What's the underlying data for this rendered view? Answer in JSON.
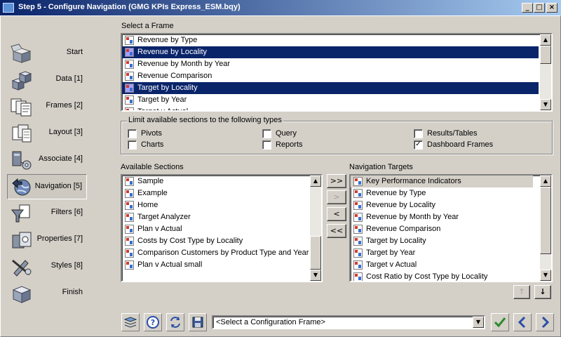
{
  "window": {
    "title": "Step 5 - Configure Navigation (GMG KPIs Express_ESM.bqy)",
    "controls": [
      "minimize-icon",
      "maximize-icon",
      "close-icon"
    ]
  },
  "steps": [
    {
      "label": "Start",
      "icon": "start-box-icon"
    },
    {
      "label": "Data [1]",
      "icon": "data-cubes-icon"
    },
    {
      "label": "Frames [2]",
      "icon": "frames-icon"
    },
    {
      "label": "Layout [3]",
      "icon": "layout-icon"
    },
    {
      "label": "Associate [4]",
      "icon": "associate-icon"
    },
    {
      "label": "Navigation [5]",
      "icon": "navigation-globe-icon",
      "active": true
    },
    {
      "label": "Filters [6]",
      "icon": "filter-funnel-icon"
    },
    {
      "label": "Properties [7]",
      "icon": "properties-icon"
    },
    {
      "label": "Styles [8]",
      "icon": "styles-brush-icon"
    },
    {
      "label": "Finish",
      "icon": "finish-cube-icon"
    }
  ],
  "select_frame": {
    "label": "Select a Frame",
    "items": [
      {
        "text": "Revenue by Type",
        "selected": false
      },
      {
        "text": "Revenue by Locality",
        "selected": true
      },
      {
        "text": "Revenue by Month by Year",
        "selected": false
      },
      {
        "text": "Revenue Comparison",
        "selected": false
      },
      {
        "text": "Target by Locality",
        "selected": true
      },
      {
        "text": "Target by Year",
        "selected": false
      },
      {
        "text": "Target v Actual",
        "selected": false
      }
    ]
  },
  "limit_types": {
    "title": "Limit available sections to the following types",
    "checkboxes": [
      {
        "label": "Pivots",
        "checked": false
      },
      {
        "label": "Charts",
        "checked": false
      },
      {
        "label": "Query",
        "checked": false
      },
      {
        "label": "Reports",
        "checked": false
      },
      {
        "label": "Results/Tables",
        "checked": false
      },
      {
        "label": "Dashboard Frames",
        "checked": true
      }
    ]
  },
  "available_sections": {
    "label": "Available Sections",
    "items": [
      "Sample",
      "Example",
      "Home",
      "Target Analyzer",
      "Plan v Actual",
      "Costs by Cost Type by Locality",
      "Comparison Customers by Product Type and Year",
      "Plan v Actual small"
    ]
  },
  "transfer_buttons": [
    ">>",
    ">",
    "<",
    "<<"
  ],
  "navigation_targets": {
    "label": "Navigation Targets",
    "items": [
      {
        "text": "Key Performance Indicators",
        "highlighted": true
      },
      {
        "text": "Revenue by Type",
        "highlighted": false
      },
      {
        "text": "Revenue by Locality",
        "highlighted": false
      },
      {
        "text": "Revenue by Month by Year",
        "highlighted": false
      },
      {
        "text": "Revenue Comparison",
        "highlighted": false
      },
      {
        "text": "Target by Locality",
        "highlighted": false
      },
      {
        "text": "Target by Year",
        "highlighted": false
      },
      {
        "text": "Target v Actual",
        "highlighted": false
      },
      {
        "text": "Cost Ratio by Cost Type by Locality",
        "highlighted": false
      }
    ]
  },
  "order_buttons": [
    "move-up-icon",
    "move-down-icon"
  ],
  "toolbar": {
    "icons": [
      "stack-icon",
      "help-icon",
      "refresh-icon",
      "save-disk-icon"
    ],
    "combo_value": "<Select a Configuration Frame>",
    "finish_icon": "checkmark-icon",
    "back_icon": "back-arrow-icon",
    "next_icon": "next-arrow-icon"
  },
  "colors": {
    "selection": "#0a246a",
    "title_start": "#0a246a",
    "title_end": "#a6caf0",
    "check_green": "#2e8b2e",
    "nav_blue": "#2a4fa8"
  }
}
